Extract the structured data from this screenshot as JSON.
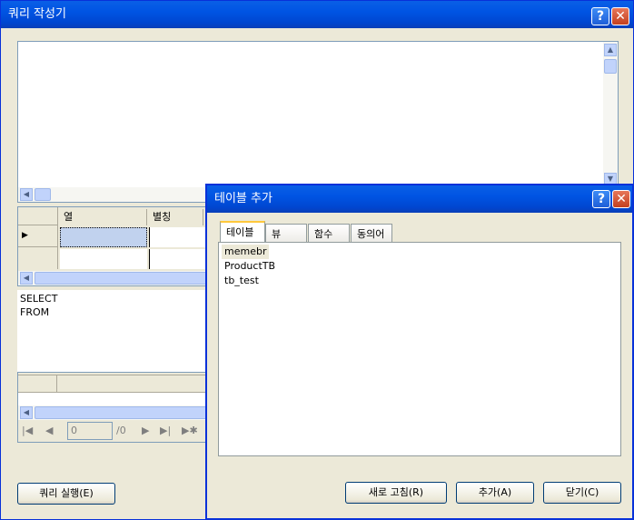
{
  "main_window": {
    "title": "쿼리 작성기",
    "help": "?",
    "close": "✕"
  },
  "grid": {
    "columns": [
      "열",
      "별칭"
    ]
  },
  "sql": {
    "lines": [
      "SELECT",
      "FROM"
    ]
  },
  "navigator": {
    "first": "|◀",
    "prev": "◀",
    "position": "0",
    "total": "/0",
    "next": "▶",
    "last": "▶|",
    "new": "▶✱"
  },
  "run_button": "쿼리 실행(E)",
  "dialog": {
    "title": "테이블 추가",
    "help": "?",
    "close": "✕",
    "tabs": [
      "테이블",
      "뷰",
      "함수",
      "동의어"
    ],
    "tables": [
      "memebr",
      "ProductTB",
      "tb_test"
    ],
    "buttons": {
      "refresh": "새로 고침(R)",
      "add": "추가(A)",
      "close": "닫기(C)"
    }
  }
}
